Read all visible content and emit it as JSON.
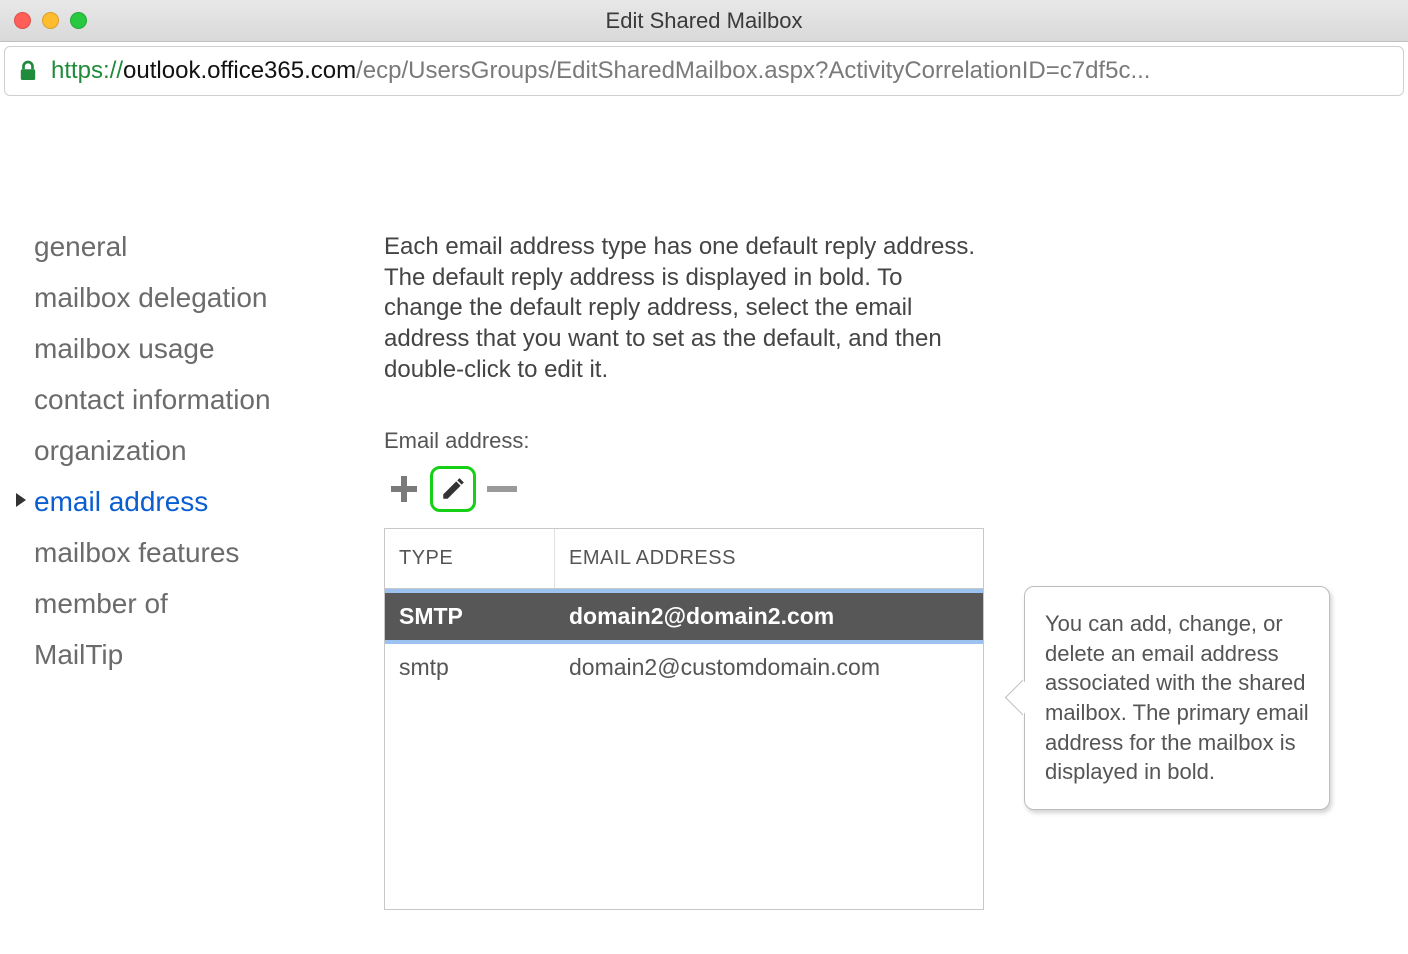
{
  "window": {
    "title": "Edit Shared Mailbox"
  },
  "url": {
    "scheme": "https://",
    "host": "outlook.office365.com",
    "rest": "/ecp/UsersGroups/EditSharedMailbox.aspx?ActivityCorrelationID=c7df5c..."
  },
  "sidenav": {
    "items": [
      {
        "label": "general",
        "selected": false
      },
      {
        "label": "mailbox delegation",
        "selected": false
      },
      {
        "label": "mailbox usage",
        "selected": false
      },
      {
        "label": "contact information",
        "selected": false
      },
      {
        "label": "organization",
        "selected": false
      },
      {
        "label": "email address",
        "selected": true
      },
      {
        "label": "mailbox features",
        "selected": false
      },
      {
        "label": "member of",
        "selected": false
      },
      {
        "label": "MailTip",
        "selected": false
      }
    ]
  },
  "main": {
    "description": "Each email address type has one default reply address. The default reply address is displayed in bold. To change the default reply address, select the email address that you want to set as the default, and then double-click to edit it.",
    "field_label": "Email address:",
    "table": {
      "headers": {
        "type": "TYPE",
        "email": "EMAIL ADDRESS"
      },
      "rows": [
        {
          "type": "SMTP",
          "email": "domain2@domain2.com",
          "primary": true,
          "selected": true
        },
        {
          "type": "smtp",
          "email": "domain2@customdomain.com",
          "primary": false,
          "selected": false
        }
      ]
    }
  },
  "callout": {
    "text": "You can add, change, or delete an email address associated with the shared mailbox. The primary email address for the mailbox is displayed in bold."
  },
  "icons": {
    "add": "plus-icon",
    "edit": "pencil-icon",
    "remove": "minus-icon",
    "lock": "lock-icon"
  }
}
